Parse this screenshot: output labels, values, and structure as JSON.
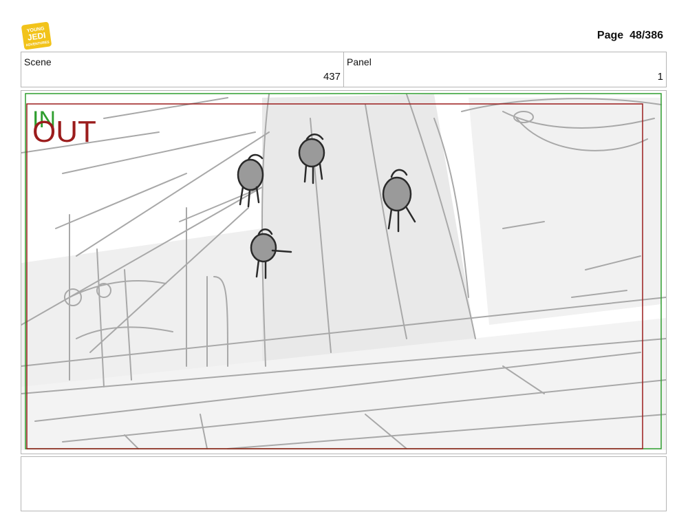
{
  "header": {
    "logo_text_line1": "YOUNG",
    "logo_text_line2": "JEDI",
    "logo_text_line3": "ADVENTURES",
    "page_label": "Page",
    "page_number": "48/386"
  },
  "info": {
    "scene_label": "Scene",
    "scene_value": "437",
    "panel_label": "Panel",
    "panel_value": "1"
  },
  "panel": {
    "in_marker": "IN",
    "out_marker": "OUT"
  },
  "colors": {
    "in_green": "#2e9e2e",
    "out_red": "#9b1c1c",
    "logo_yellow": "#f2c31a",
    "sketch_gray": "#a8a8a8"
  }
}
